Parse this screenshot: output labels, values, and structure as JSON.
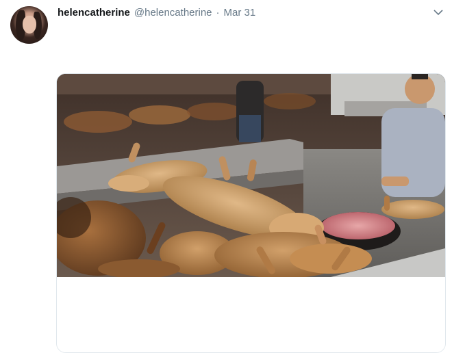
{
  "tweet": {
    "display_name": "helencatherine",
    "handle": "@helencatherine",
    "separator": "·",
    "timestamp": "Mar 31",
    "more_icon": "chevron-down-icon"
  },
  "colors": {
    "name": "#14171a",
    "secondary": "#657786",
    "border": "#e1e8ed"
  }
}
